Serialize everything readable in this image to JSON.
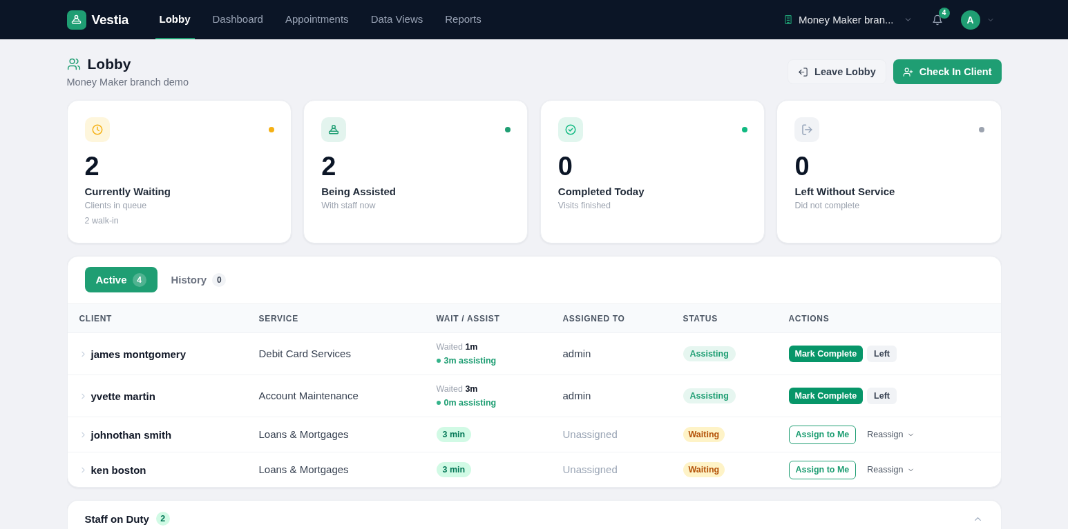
{
  "nav": {
    "brand": "Vestia",
    "items": [
      {
        "label": "Lobby",
        "selected": true
      },
      {
        "label": "Dashboard",
        "selected": false
      },
      {
        "label": "Appointments",
        "selected": false
      },
      {
        "label": "Data Views",
        "selected": false
      },
      {
        "label": "Reports",
        "selected": false
      }
    ],
    "branch": "Money Maker bran...",
    "notification_count": "4",
    "avatar": "A"
  },
  "page": {
    "title": "Lobby",
    "subtitle": "Money Maker branch demo",
    "actions": [
      {
        "kind": "exit",
        "label": "Leave Lobby"
      },
      {
        "kind": "add",
        "label": "Check In Client"
      }
    ]
  },
  "stats": [
    {
      "kind": "waiting",
      "color": "#f5b014",
      "value": "2",
      "label": "Currently Waiting",
      "caption": "Clients in queue",
      "note": "2 walk-in"
    },
    {
      "kind": "assisted",
      "color": "#1f9e73",
      "value": "2",
      "label": "Being Assisted",
      "caption": "With staff now"
    },
    {
      "kind": "completed",
      "color": "#10b981",
      "value": "0",
      "label": "Completed Today",
      "caption": "Visits finished"
    },
    {
      "kind": "left",
      "color": "#9ca3af",
      "value": "0",
      "label": "Left Without Service",
      "caption": "Did not complete"
    }
  ],
  "queue": {
    "tabs": [
      {
        "label": "Active",
        "count": "4",
        "selected": true
      },
      {
        "label": "History",
        "count": "0",
        "selected": false
      }
    ],
    "columns": [
      "CLIENT",
      "SERVICE",
      "WAIT / ASSIST",
      "ASSIGNED TO",
      "STATUS",
      "ACTIONS"
    ],
    "rows": [
      {
        "expanded": false,
        "client": "james montgomery",
        "service": "Debit Card Services",
        "wait": {
          "kind": "assisting",
          "waited": "Waited **1m**",
          "assisting": "3m assisting"
        },
        "assigned_to": "admin",
        "assigned": true,
        "status": {
          "kind": "assisting",
          "label": "Assisting"
        },
        "actions": [
          {
            "kind": "complete",
            "label": "Mark Complete"
          },
          {
            "kind": "left",
            "label": "Left"
          }
        ]
      },
      {
        "expanded": false,
        "client": "yvette martin",
        "service": "Account Maintenance",
        "wait": {
          "kind": "assisting",
          "waited": "Waited **3m**",
          "assisting": "0m assisting"
        },
        "assigned_to": "admin",
        "assigned": true,
        "status": {
          "kind": "assisting",
          "label": "Assisting"
        },
        "actions": [
          {
            "kind": "complete",
            "label": "Mark Complete"
          },
          {
            "kind": "left",
            "label": "Left"
          }
        ]
      },
      {
        "expanded": false,
        "client": "johnothan smith",
        "service": "Loans & Mortgages",
        "wait": {
          "kind": "queued",
          "label": "3 min"
        },
        "assigned_to": "Unassigned",
        "assigned": false,
        "status": {
          "kind": "waiting",
          "label": "Waiting"
        },
        "actions": [
          {
            "kind": "assign",
            "label": "Assign to Me"
          },
          {
            "kind": "reassign",
            "label": "Reassign"
          }
        ]
      },
      {
        "expanded": false,
        "client": "ken boston",
        "service": "Loans & Mortgages",
        "wait": {
          "kind": "queued",
          "label": "3 min"
        },
        "assigned_to": "Unassigned",
        "assigned": false,
        "status": {
          "kind": "waiting",
          "label": "Waiting"
        },
        "actions": [
          {
            "kind": "assign",
            "label": "Assign to Me"
          },
          {
            "kind": "reassign",
            "label": "Reassign"
          }
        ]
      }
    ]
  },
  "staff": {
    "title": "Staff on Duty",
    "count": "2",
    "expanded": true
  }
}
